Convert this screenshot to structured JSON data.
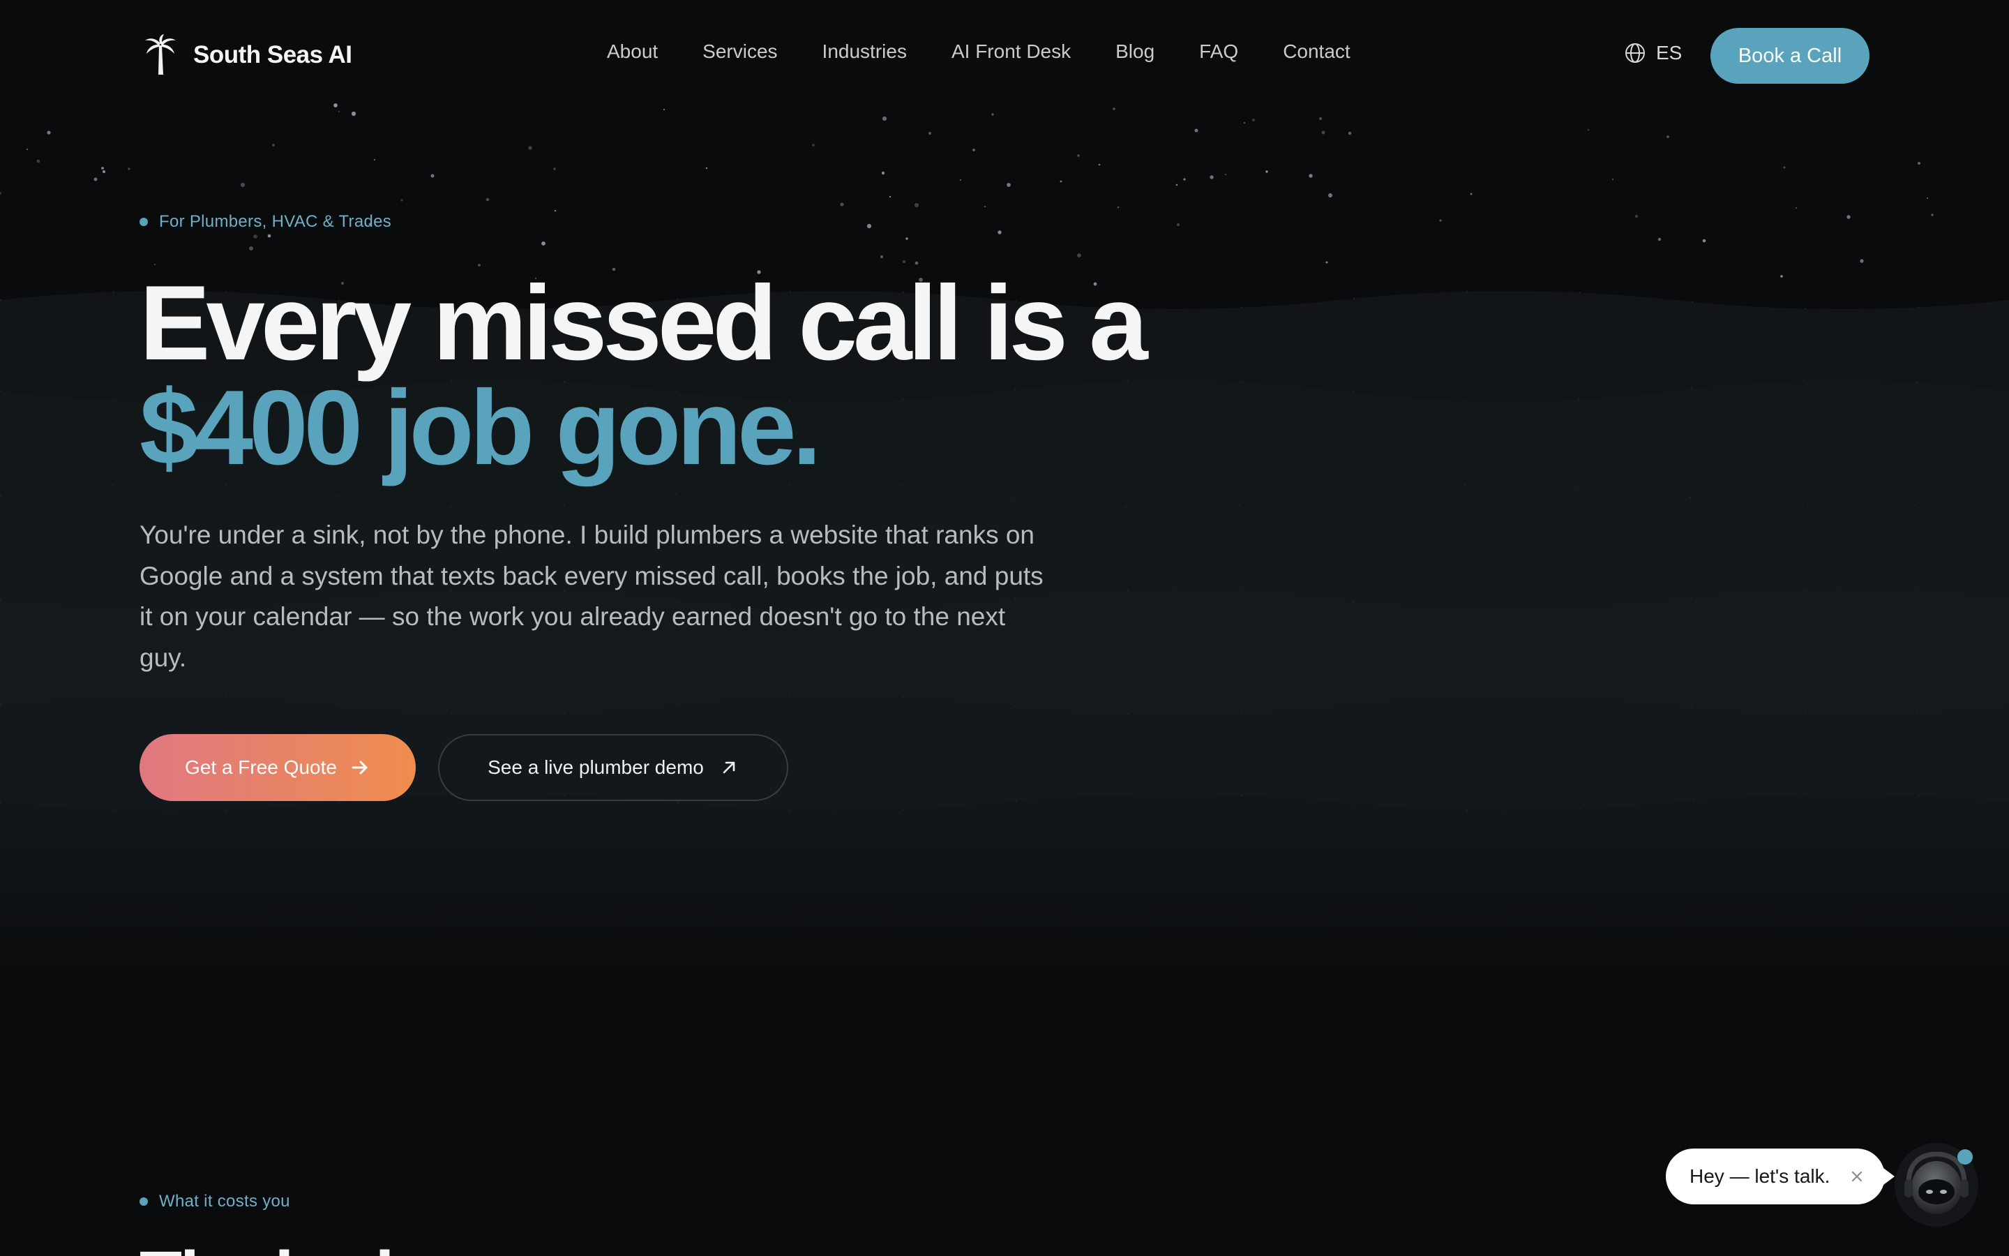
{
  "brand": {
    "name": "South Seas AI",
    "icon": "palm-tree-icon"
  },
  "nav": {
    "links": [
      "About",
      "Services",
      "Industries",
      "AI Front Desk",
      "Blog",
      "FAQ",
      "Contact"
    ],
    "language": "ES",
    "language_icon": "globe-icon",
    "cta": "Book a Call"
  },
  "hero": {
    "eyebrow": "For Plumbers, HVAC & Trades",
    "title_line1": "Every missed call is a",
    "title_line2": "$400 job gone.",
    "subtitle": "You're under a sink, not by the phone. I build plumbers a website that ranks on Google and a system that texts back every missed call, books the job, and puts it on your calendar — so the work you already earned doesn't go to the next guy.",
    "cta_primary": "Get a Free Quote",
    "cta_primary_icon": "arrow-right-icon",
    "cta_secondary": "See a live plumber demo",
    "cta_secondary_icon": "arrow-up-right-icon"
  },
  "section2": {
    "eyebrow": "What it costs you",
    "title": "The bad"
  },
  "chat": {
    "greeting": "Hey — let's talk.",
    "close_icon": "close-icon",
    "avatar_icon": "robot-avatar-icon"
  },
  "colors": {
    "accent": "#5aa3bd",
    "background": "#0a0b0c",
    "cta_gradient_start": "#e07882",
    "cta_gradient_end": "#ef8d4e"
  }
}
